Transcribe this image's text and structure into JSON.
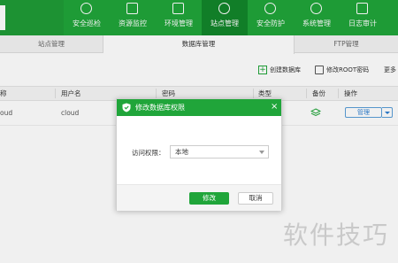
{
  "colors": {
    "brand": "#20a53a",
    "brand_dark": "#13862b",
    "link_blue": "#2d7fd1"
  },
  "nav": {
    "items": [
      {
        "label": "安全巡检",
        "icon": "target-icon"
      },
      {
        "label": "资源监控",
        "icon": "monitor-icon"
      },
      {
        "label": "环境管理",
        "icon": "server-icon"
      },
      {
        "label": "站点管理",
        "icon": "globe-icon"
      },
      {
        "label": "安全防护",
        "icon": "shield-icon"
      },
      {
        "label": "系统管理",
        "icon": "gear-icon"
      },
      {
        "label": "日志审计",
        "icon": "log-icon"
      }
    ],
    "active_index": 3
  },
  "subtabs": [
    {
      "label": "站点管理"
    },
    {
      "label": "数据库管理"
    },
    {
      "label": "FTP管理"
    }
  ],
  "toolbar": {
    "create_db": "创建数据库",
    "modify_root_pw": "修改ROOT密码",
    "more": "更多"
  },
  "table": {
    "headers": {
      "name": "称",
      "username": "用户名",
      "password": "密码",
      "type": "类型",
      "backup": "备份",
      "actions": "操作"
    },
    "rows": [
      {
        "name": "oud",
        "username": "cloud",
        "action_label": "管理"
      }
    ]
  },
  "modal": {
    "title": "修改数据库权限",
    "close": "×",
    "access_label": "访问权限：",
    "access_value": "本地",
    "ok_label": "修改",
    "cancel_label": "取消"
  },
  "watermark": "软件技巧"
}
